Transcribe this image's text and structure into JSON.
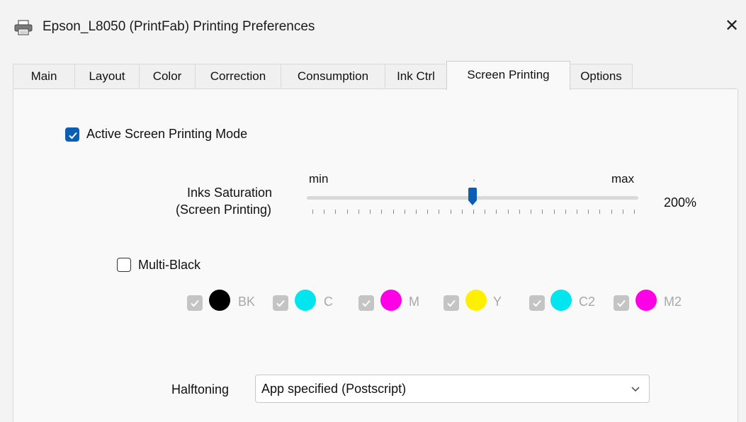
{
  "window": {
    "title": "Epson_L8050 (PrintFab) Printing Preferences",
    "close_icon": "close-icon",
    "printer_icon": "printer-icon"
  },
  "tabs": [
    {
      "label": "Main"
    },
    {
      "label": "Layout"
    },
    {
      "label": "Color"
    },
    {
      "label": "Correction"
    },
    {
      "label": "Consumption"
    },
    {
      "label": "Ink Ctrl"
    },
    {
      "label": "Screen Printing",
      "active": true
    },
    {
      "label": "Options"
    }
  ],
  "screen_printing": {
    "active_mode": {
      "label": "Active Screen Printing Mode",
      "checked": true
    },
    "saturation": {
      "label_line1": "Inks Saturation",
      "label_line2": "(Screen Printing)",
      "min_label": "min",
      "max_label": "max",
      "value_text": "200%",
      "position_fraction": 0.5
    },
    "multi_black": {
      "label": "Multi-Black",
      "checked": false
    },
    "inks": [
      {
        "label": "BK",
        "color": "#000000",
        "checked": true,
        "enabled": false
      },
      {
        "label": "C",
        "color": "#00e5ee",
        "checked": true,
        "enabled": false
      },
      {
        "label": "M",
        "color": "#ff00e6",
        "checked": true,
        "enabled": false
      },
      {
        "label": "Y",
        "color": "#ffef00",
        "checked": true,
        "enabled": false
      },
      {
        "label": "C2",
        "color": "#00e5ee",
        "checked": true,
        "enabled": false
      },
      {
        "label": "M2",
        "color": "#ff00e6",
        "checked": true,
        "enabled": false
      }
    ],
    "halftoning": {
      "label": "Halftoning",
      "selected": "App specified (Postscript)"
    }
  },
  "colors": {
    "accent": "#0a5fb4",
    "window_bg": "#f3f3f3",
    "panel_bg": "#f9f9f9"
  }
}
